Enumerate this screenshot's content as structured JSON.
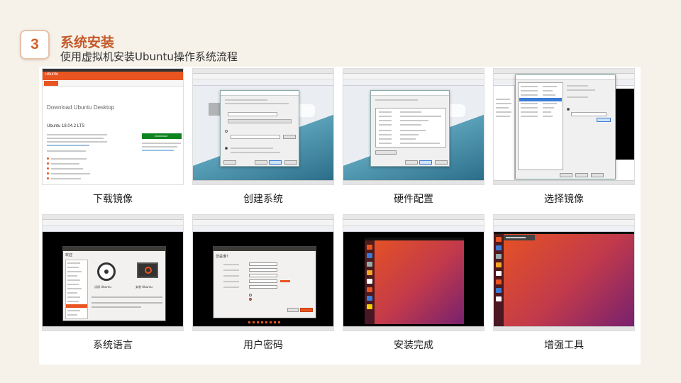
{
  "header": {
    "number": "3",
    "title": "系统安装",
    "subtitle": "使用虚拟机安装Ubuntu操作系统流程"
  },
  "steps": [
    {
      "caption": "下载镜像",
      "screen": {
        "heading": "Download Ubuntu Desktop",
        "version": "Ubuntu 18.04.2 LTS",
        "download_label": "Download",
        "brand": "ubuntu"
      }
    },
    {
      "caption": "创建系统"
    },
    {
      "caption": "硬件配置"
    },
    {
      "caption": "选择镜像"
    },
    {
      "caption": "系统语言",
      "screen": {
        "option_try": "试用 Ubuntu",
        "option_install": "安装 Ubuntu",
        "heading": "欢迎"
      }
    },
    {
      "caption": "用户密码",
      "screen": {
        "heading": "您是谁？"
      }
    },
    {
      "caption": "安装完成"
    },
    {
      "caption": "增强工具"
    }
  ],
  "colors": {
    "accent": "#d2622a",
    "ubuntu_orange": "#e95420",
    "page_bg": "#f6f2ea"
  }
}
